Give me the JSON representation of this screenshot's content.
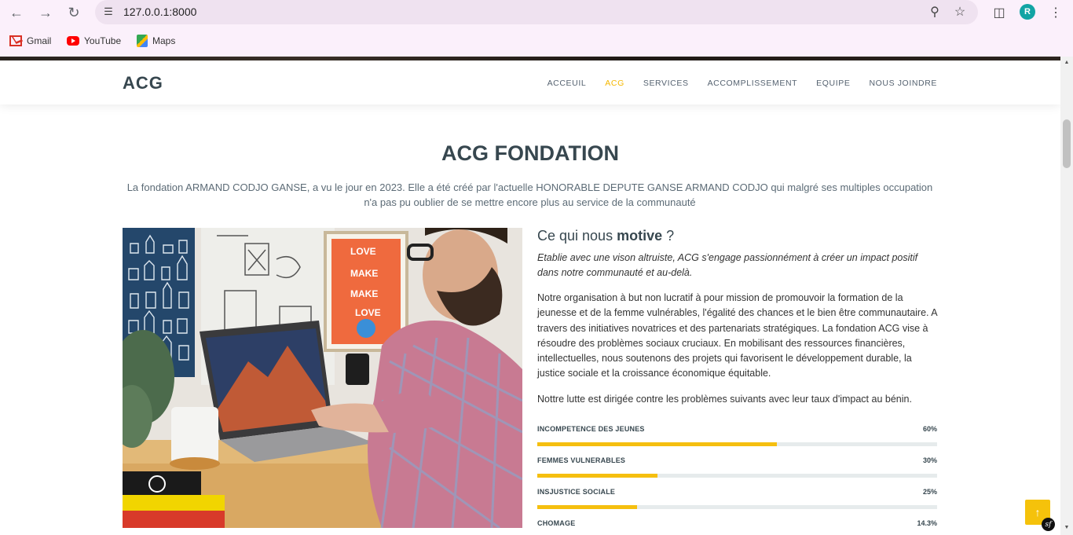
{
  "browser": {
    "url": "127.0.0.1:8000",
    "avatar_letter": "R",
    "bookmarks": [
      {
        "label": "Gmail",
        "icon": "gmail-icon"
      },
      {
        "label": "YouTube",
        "icon": "youtube-icon"
      },
      {
        "label": "Maps",
        "icon": "maps-icon"
      }
    ]
  },
  "header": {
    "logo": "ACG",
    "nav": [
      {
        "label": "ACCEUIL",
        "active": false
      },
      {
        "label": "ACG",
        "active": true
      },
      {
        "label": "SERVICES",
        "active": false
      },
      {
        "label": "ACCOMPLISSEMENT",
        "active": false
      },
      {
        "label": "EQUIPE",
        "active": false
      },
      {
        "label": "NOUS JOINDRE",
        "active": false
      }
    ],
    "accent_color": "#f5b700"
  },
  "about": {
    "title": "ACG FONDATION",
    "description": "La fondation ARMAND CODJO GANSE, a vu le jour en 2023. Elle a été créé par l'actuelle HONORABLE DEPUTE GANSE ARMAND CODJO qui malgré ses multiples occupation n'a pas pu oublier de se mettre encore plus au service de la communauté",
    "heading_pre": "Ce qui nous ",
    "heading_bold": "motive",
    "heading_post": " ?",
    "lead": "Etablie avec une vison altruiste, ACG s'engage passionnément à créer un impact positif dans notre communauté et au-delà.",
    "paragraph1": "Notre organisation à but non lucratif à pour mission de promouvoir la formation de la jeunesse et de la femme vulnérables, l'égalité des chances et le bien être communautaire. A travers des initiatives novatrices et des partenariats stratégiques. La fondation ACG vise à résoudre des problèmes sociaux cruciaux. En mobilisant des ressources financières, intellectuelles, nous soutenons des projets qui favorisent le développement durable, la justice sociale et la croissance économique équitable.",
    "paragraph2": "Nottre lutte est dirigée contre les problèmes suivants avec leur taux d'impact au bénin.",
    "skills": [
      {
        "label": "INCOMPETENCE DES JEUNES",
        "value": "60%",
        "percent": 60
      },
      {
        "label": "FEMMES VULNERABLES",
        "value": "30%",
        "percent": 30
      },
      {
        "label": "INSJUSTICE SOCIALE",
        "value": "25%",
        "percent": 25
      },
      {
        "label": "CHOMAGE",
        "value": "14.3%",
        "percent": 14.3
      }
    ],
    "bar_color": "#f5bf0f"
  },
  "widgets": {
    "back_to_top_icon": "arrow-up-icon",
    "symfony_badge": "sf"
  }
}
